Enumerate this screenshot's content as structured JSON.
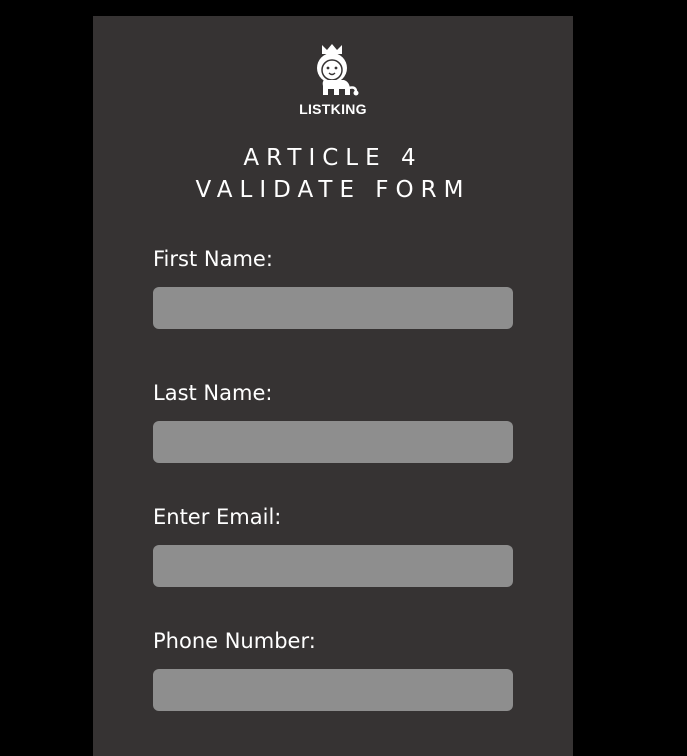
{
  "brand": {
    "name": "LISTKING",
    "logo_icon": "lion-with-crown-icon"
  },
  "heading": {
    "line1": "ARTICLE 4",
    "line2": "VALIDATE FORM"
  },
  "form": {
    "first_name": {
      "label": "First Name:",
      "value": "",
      "placeholder": ""
    },
    "last_name": {
      "label": "Last Name:",
      "value": "",
      "placeholder": ""
    },
    "email": {
      "label": "Enter Email:",
      "value": "",
      "placeholder": ""
    },
    "phone": {
      "label": "Phone Number:",
      "value": "",
      "placeholder": ""
    }
  },
  "colors": {
    "page_background": "#000000",
    "card_background": "#363333",
    "field_background": "#8e8e8e",
    "text": "#ffffff"
  }
}
